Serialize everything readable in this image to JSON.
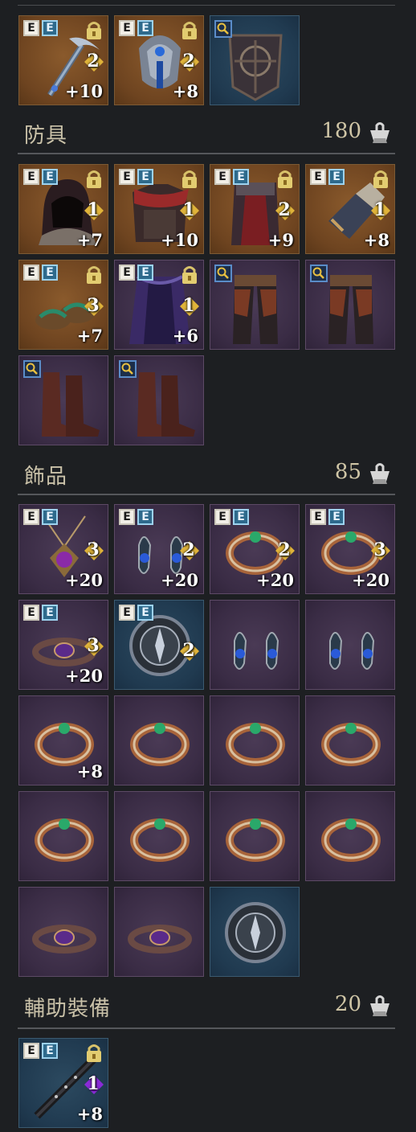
{
  "sections": {
    "weapons": {
      "items": [
        {
          "icon": "pickaxe-icon",
          "frame": "brown",
          "equipped": true,
          "locked": true,
          "tier": "2",
          "upgrade": "+10"
        },
        {
          "icon": "helmet-icon",
          "frame": "brown",
          "equipped": true,
          "locked": true,
          "tier": "2",
          "upgrade": "+8"
        },
        {
          "icon": "shield-icon",
          "frame": "blue",
          "inspect": true
        }
      ]
    },
    "armor": {
      "title": "防具",
      "count": "180",
      "items": [
        {
          "icon": "hood-icon",
          "frame": "brown",
          "equipped": true,
          "locked": true,
          "tier": "1",
          "upgrade": "+7"
        },
        {
          "icon": "chest-armor-icon",
          "frame": "brown",
          "equipped": true,
          "locked": true,
          "tier": "1",
          "upgrade": "+10"
        },
        {
          "icon": "tunic-icon",
          "frame": "brown",
          "equipped": true,
          "locked": true,
          "tier": "2",
          "upgrade": "+9"
        },
        {
          "icon": "gauntlet-icon",
          "frame": "brown",
          "equipped": true,
          "locked": true,
          "tier": "1",
          "upgrade": "+8"
        },
        {
          "icon": "sandals-icon",
          "frame": "brown",
          "equipped": true,
          "locked": true,
          "tier": "3",
          "upgrade": "+7"
        },
        {
          "icon": "cloak-icon",
          "frame": "purple",
          "equipped": true,
          "locked": true,
          "tier": "1",
          "upgrade": "+6"
        },
        {
          "icon": "leg-armor-icon",
          "frame": "purple",
          "inspect": true
        },
        {
          "icon": "leg-armor-icon",
          "frame": "purple",
          "inspect": true
        },
        {
          "icon": "boots-icon",
          "frame": "purple",
          "inspect": true
        },
        {
          "icon": "boots-icon",
          "frame": "purple",
          "inspect": true
        }
      ]
    },
    "accessories": {
      "title": "飾品",
      "count": "85",
      "items": [
        {
          "icon": "amulet-icon",
          "frame": "purple",
          "equipped": true,
          "tier": "3",
          "upgrade": "+20"
        },
        {
          "icon": "earrings-icon",
          "frame": "purple",
          "equipped": true,
          "tier": "2",
          "upgrade": "+20"
        },
        {
          "icon": "ring-icon",
          "frame": "purple",
          "equipped": true,
          "tier": "2",
          "upgrade": "+20"
        },
        {
          "icon": "ring-icon",
          "frame": "purple",
          "equipped": true,
          "tier": "3",
          "upgrade": "+20"
        },
        {
          "icon": "belt-icon",
          "frame": "purple",
          "equipped": true,
          "tier": "3",
          "upgrade": "+20"
        },
        {
          "icon": "emblem-icon",
          "frame": "blue",
          "equipped": true,
          "tier": "2"
        },
        {
          "icon": "earrings-icon",
          "frame": "purple"
        },
        {
          "icon": "earrings-icon",
          "frame": "purple"
        },
        {
          "icon": "ring-icon",
          "frame": "purple",
          "upgrade": "+8"
        },
        {
          "icon": "ring-icon",
          "frame": "purple"
        },
        {
          "icon": "ring-icon",
          "frame": "purple"
        },
        {
          "icon": "ring-icon",
          "frame": "purple"
        },
        {
          "icon": "ring-icon",
          "frame": "purple"
        },
        {
          "icon": "ring-icon",
          "frame": "purple"
        },
        {
          "icon": "ring-icon",
          "frame": "purple"
        },
        {
          "icon": "ring-icon",
          "frame": "purple"
        },
        {
          "icon": "belt-icon",
          "frame": "purple"
        },
        {
          "icon": "belt-icon",
          "frame": "purple"
        },
        {
          "icon": "emblem-icon",
          "frame": "blue"
        }
      ]
    },
    "auxiliary": {
      "title": "輔助裝備",
      "count": "20",
      "items": [
        {
          "icon": "flute-icon",
          "frame": "blue",
          "equipped": true,
          "locked": true,
          "tier": "1",
          "tier_color": "purple",
          "upgrade": "+8"
        }
      ]
    }
  },
  "labels": {
    "equip_badge": "E"
  }
}
